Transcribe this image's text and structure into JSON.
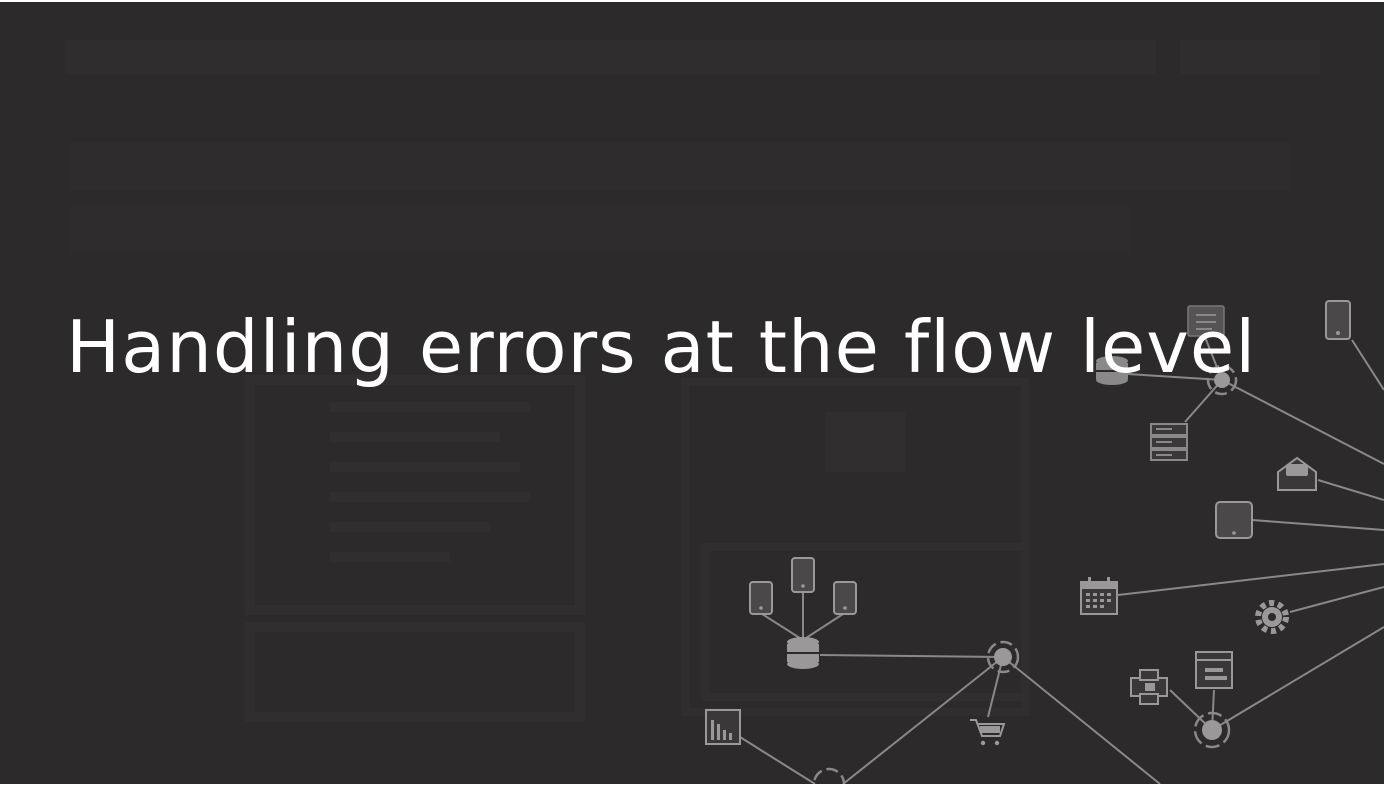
{
  "slide": {
    "title": "Handling errors at the flow level",
    "background_color": "#2c2a2a",
    "title_color": "#ffffff",
    "line_color": "#8a8888"
  },
  "network_icons": [
    "document-icon",
    "mobile-phone-icon",
    "database-icon",
    "hub-node-icon",
    "server-rack-icon",
    "email-icon",
    "tablet-icon",
    "calendar-icon",
    "gear-icon",
    "browser-window-icon",
    "printer-icon",
    "shopping-cart-icon",
    "bar-chart-icon"
  ]
}
